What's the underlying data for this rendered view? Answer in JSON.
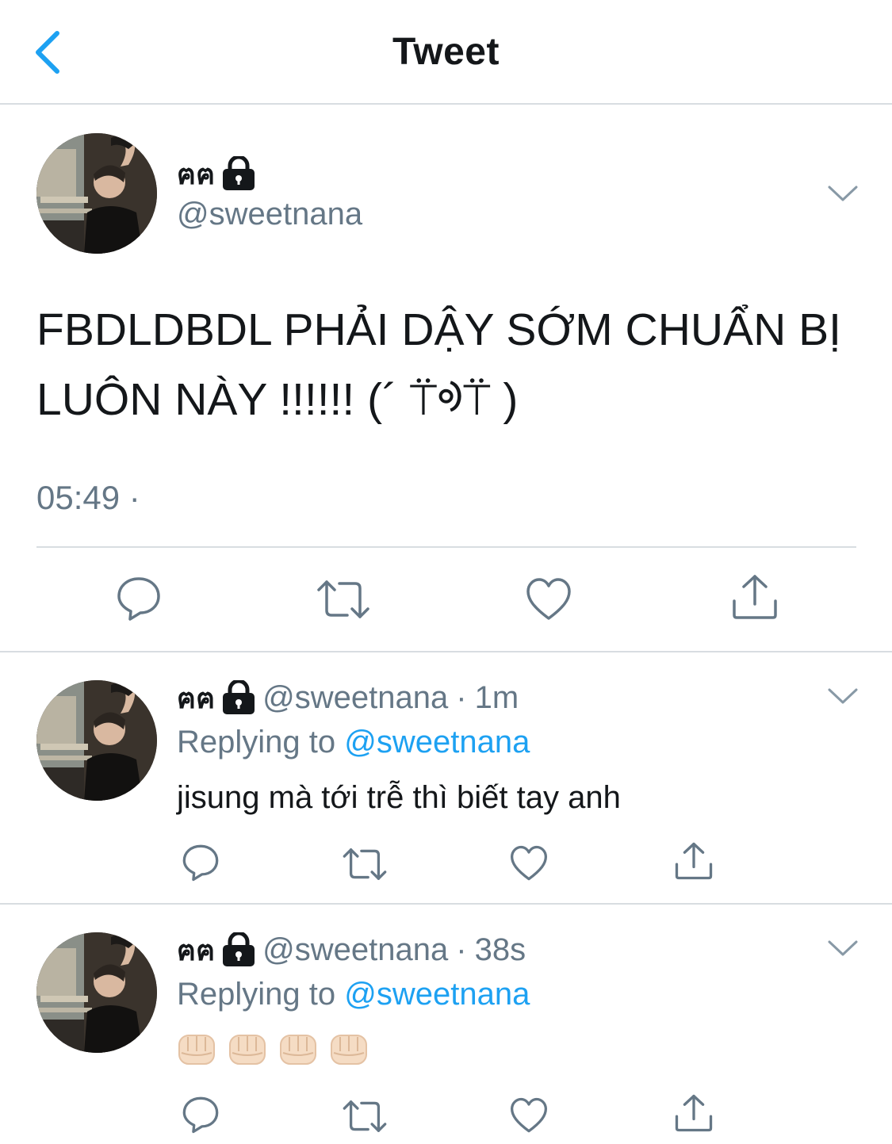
{
  "header": {
    "title": "Tweet"
  },
  "main_tweet": {
    "name": "ฅฅ",
    "handle": "@sweetnana",
    "text_line1": "FBDLDBDL PHẢI DẬY SỚM CHUẨN BỊ",
    "text_line2": "LUÔN NÀY !!!!!! (´ ⍡ᢀ⍡ )",
    "time": "05:49 ·"
  },
  "replies": [
    {
      "name": "ฅฅ",
      "handle": "@sweetnana",
      "separator": "·",
      "age": "1m",
      "replying_prefix": "Replying to",
      "replying_to": "@sweetnana",
      "text": "jisung mà tới trễ thì biết tay anh"
    },
    {
      "name": "ฅฅ",
      "handle": "@sweetnana",
      "separator": "·",
      "age": "38s",
      "replying_prefix": "Replying to",
      "replying_to": "@sweetnana",
      "emoji": [
        "👊🏻",
        "👊🏻",
        "👊🏻",
        "👊🏻"
      ]
    }
  ],
  "icons": {
    "back": "chevron-left-icon",
    "lock": "lock-icon",
    "more": "chevron-down-icon",
    "reply": "reply-bubble-icon",
    "retweet": "retweet-icon",
    "like": "heart-icon",
    "share": "share-icon"
  },
  "colors": {
    "accent": "#1da1f2",
    "secondary_text": "#657786",
    "divider": "#d8dde1",
    "icon": "#657786"
  }
}
